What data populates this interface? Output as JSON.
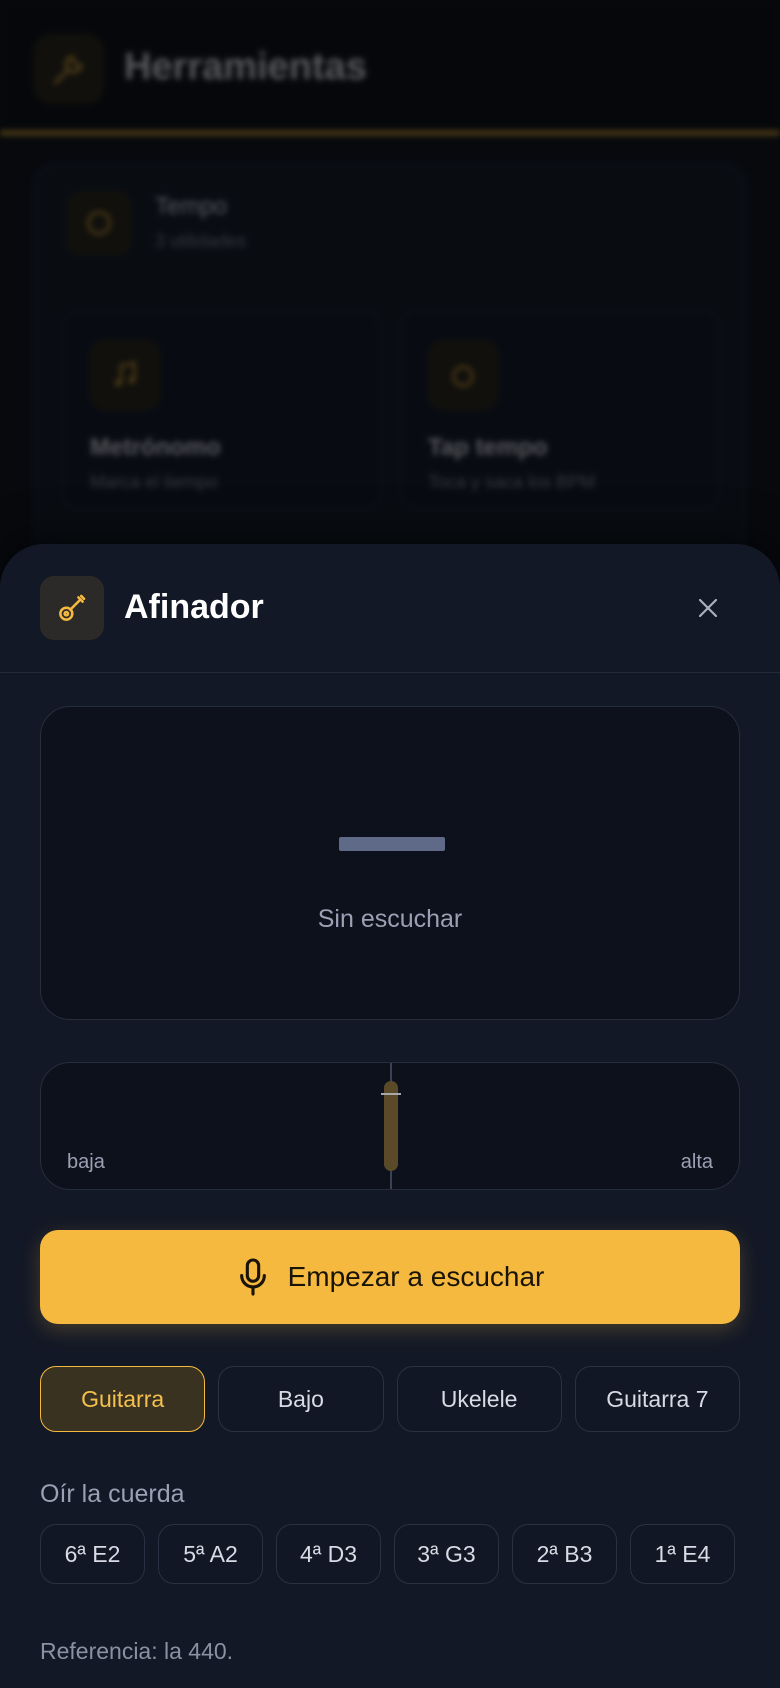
{
  "background": {
    "title": "Herramientas",
    "section_title": "Tempo",
    "section_subtitle": "3 utilidades",
    "tiles": [
      {
        "title": "Metrónomo",
        "subtitle": "Marca el tiempo"
      },
      {
        "title": "Tap tempo",
        "subtitle": "Toca y saca los BPM"
      }
    ]
  },
  "sheet": {
    "title": "Afinador",
    "icon": "guitar-icon",
    "close_icon": "close-icon"
  },
  "display": {
    "note": "—",
    "status": "Sin escuchar"
  },
  "meter": {
    "low_label": "baja",
    "high_label": "alta",
    "cents_offset": 0
  },
  "listen_button": {
    "label": "Empezar a escuchar",
    "icon": "microphone-icon"
  },
  "instruments": [
    {
      "label": "Guitarra",
      "active": true
    },
    {
      "label": "Bajo",
      "active": false
    },
    {
      "label": "Ukelele",
      "active": false
    },
    {
      "label": "Guitarra 7",
      "active": false
    }
  ],
  "strings_section": {
    "label": "Oír la cuerda",
    "strings": [
      "6ª E2",
      "5ª A2",
      "4ª D3",
      "3ª G3",
      "2ª B3",
      "1ª E4"
    ]
  },
  "reference": "Referencia: la 440.",
  "colors": {
    "accent": "#f5b93f",
    "sheet_bg": "#131826",
    "panel_bg": "#0d111b"
  }
}
